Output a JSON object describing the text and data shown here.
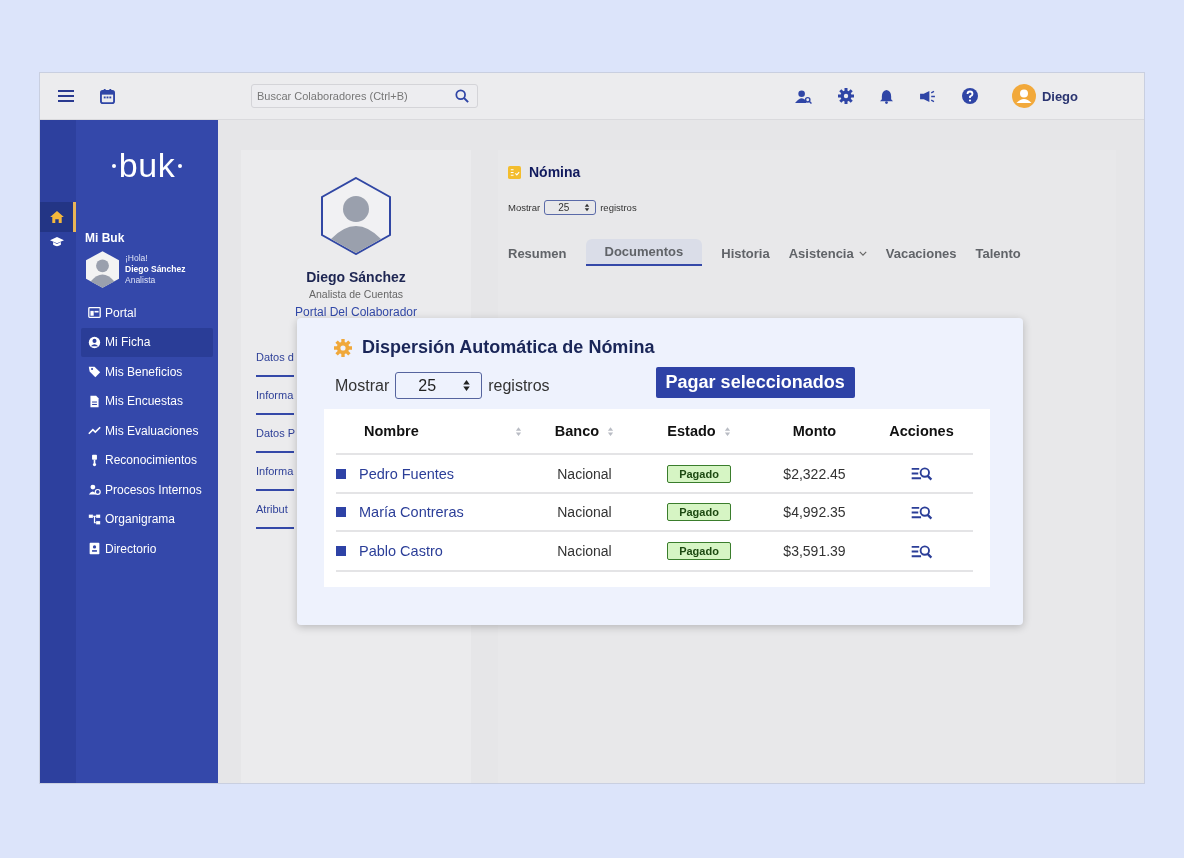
{
  "topbar": {
    "search": {
      "placeholder": "Buscar Colaboradores (Ctrl+B)"
    },
    "user": "Diego"
  },
  "rail": [
    {
      "kind": "home",
      "selected": true
    },
    {
      "kind": "cap",
      "selected": false
    }
  ],
  "sidebar": {
    "logo": "buk",
    "section": "Mi Buk",
    "greeting": "¡Hola!",
    "user_name": "Diego Sánchez",
    "user_role": "Analista",
    "items": [
      {
        "kind": "portal",
        "label": "Portal",
        "selected": false
      },
      {
        "kind": "user",
        "label": "Mi Ficha",
        "selected": true
      },
      {
        "kind": "tag",
        "label": "Mis Beneficios",
        "selected": false
      },
      {
        "kind": "doc",
        "label": "Mis Encuestas",
        "selected": false
      },
      {
        "kind": "trend",
        "label": "Mis Evaluaciones",
        "selected": false
      },
      {
        "kind": "medal",
        "label": "Reconocimientos",
        "selected": false
      },
      {
        "kind": "people",
        "label": "Procesos Internos",
        "selected": false
      },
      {
        "kind": "org",
        "label": "Organigrama",
        "selected": false
      },
      {
        "kind": "book",
        "label": "Directorio",
        "selected": false
      }
    ]
  },
  "profile": {
    "name": "Diego Sánchez",
    "role": "Analista de Cuentas",
    "portal_link": "Portal Del Colaborador",
    "links": [
      "Datos d",
      "Informa",
      "Datos P",
      "Informa",
      "Atribut"
    ]
  },
  "nomina": {
    "title": "Nómina",
    "show_label": "Mostrar",
    "page_size": "25",
    "records_label": "registros",
    "tabs": [
      {
        "label": "Resumen",
        "selected": false,
        "has_menu": false
      },
      {
        "label": "Documentos",
        "selected": true,
        "has_menu": false
      },
      {
        "label": "Historia",
        "selected": false,
        "has_menu": false
      },
      {
        "label": "Asistencia",
        "selected": false,
        "has_menu": true
      },
      {
        "label": "Vacaciones",
        "selected": false,
        "has_menu": false
      },
      {
        "label": "Talento",
        "selected": false,
        "has_menu": false
      }
    ]
  },
  "modal": {
    "title": "Dispersión Automática de Nómina",
    "show_label": "Mostrar",
    "page_size": "25",
    "records_label": "registros",
    "pay_button": "Pagar seleccionados",
    "columns": [
      {
        "label": "Nombre",
        "sortable": true
      },
      {
        "label": "Banco",
        "sortable": true
      },
      {
        "label": "Estado",
        "sortable": true
      },
      {
        "label": "Monto",
        "sortable": false
      },
      {
        "label": "Acciones",
        "sortable": false
      }
    ],
    "rows": [
      {
        "checked": true,
        "name": "Pedro Fuentes",
        "bank": "Nacional",
        "status": "Pagado",
        "amount": "$2,322.45"
      },
      {
        "checked": true,
        "name": "María Contreras",
        "bank": "Nacional",
        "status": "Pagado",
        "amount": "$4,992.35"
      },
      {
        "checked": true,
        "name": "Pablo Castro",
        "bank": "Nacional",
        "status": "Pagado",
        "amount": "$3,591.39"
      }
    ]
  }
}
